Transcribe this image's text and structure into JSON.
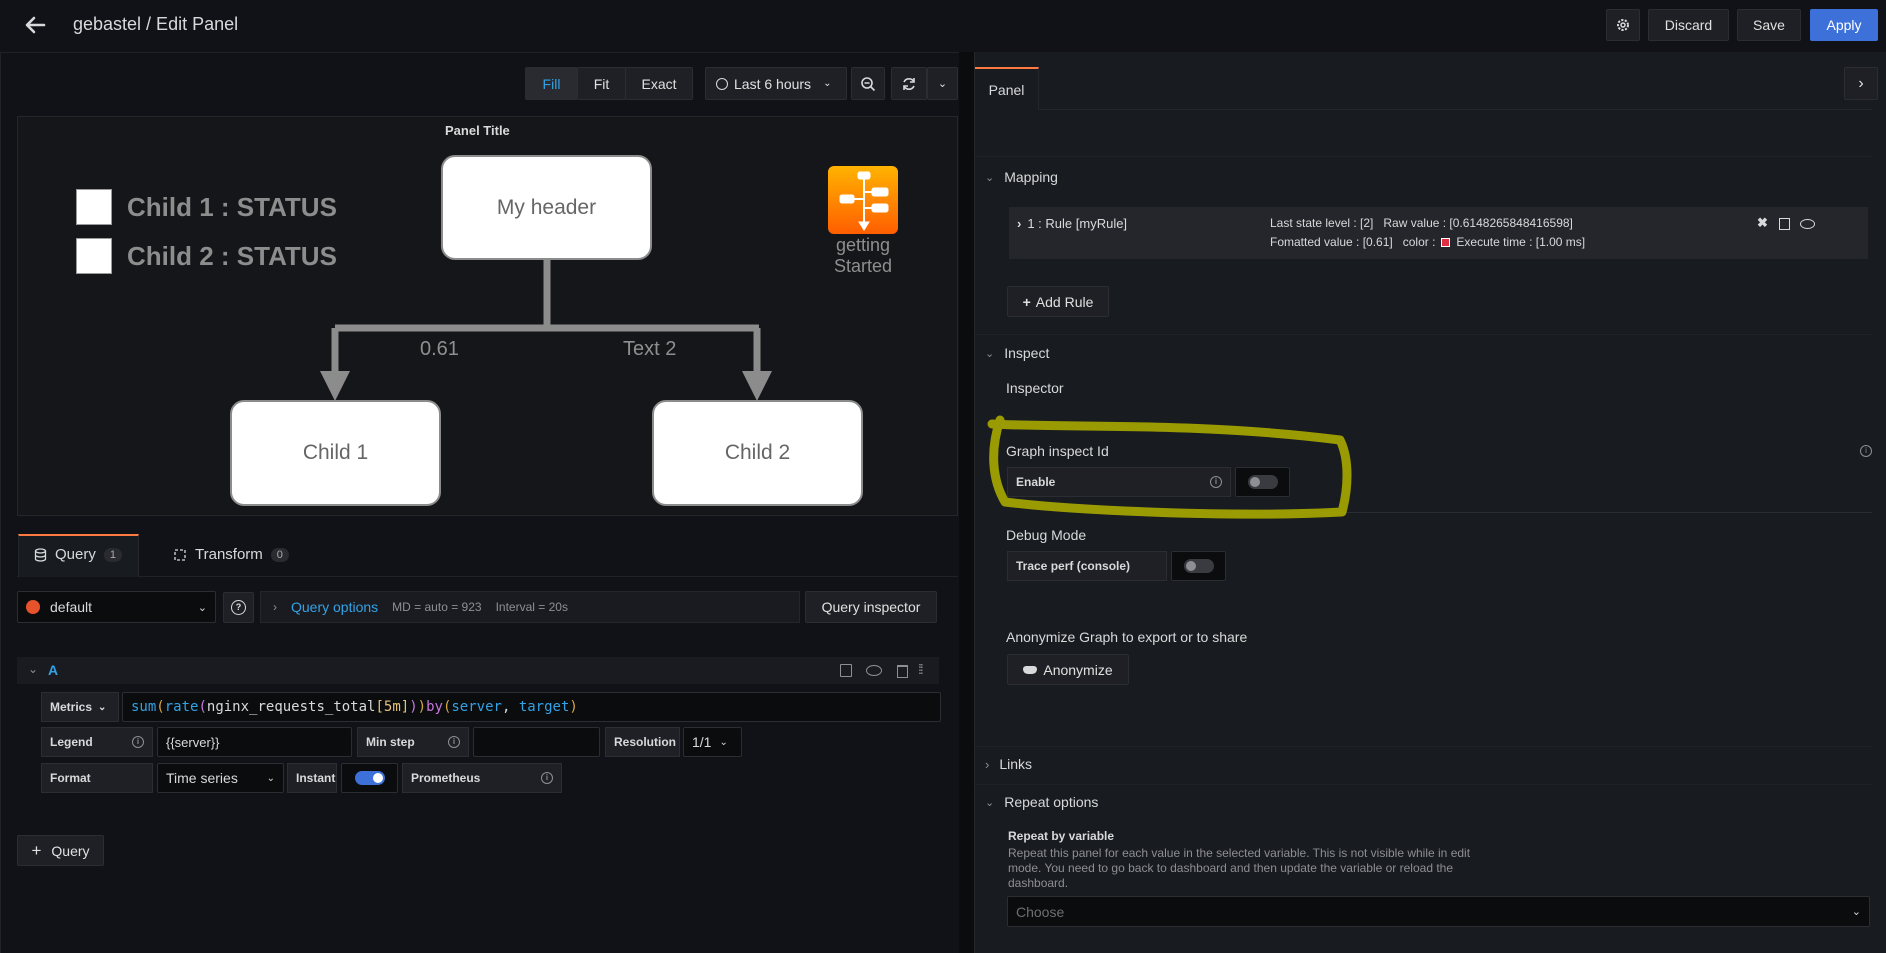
{
  "header": {
    "title": "gebastel / Edit Panel",
    "discard": "Discard",
    "save": "Save",
    "apply": "Apply"
  },
  "viz_toolbar": {
    "fill": "Fill",
    "fit": "Fit",
    "exact": "Exact",
    "time_range": "Last 6 hours"
  },
  "panel": {
    "title": "Panel Title",
    "header_node": "My header",
    "child1": "Child 1",
    "child2": "Child 2",
    "link1": "0.61",
    "link2": "Text 2",
    "status1": "Child 1 : STATUS",
    "status2": "Child 2 : STATUS",
    "getting_started_1": "getting",
    "getting_started_2": "Started"
  },
  "query_tabs": {
    "query": "Query",
    "query_count": "1",
    "transform": "Transform",
    "transform_count": "0"
  },
  "query_bar": {
    "datasource": "default",
    "options": "Query options",
    "md": "MD = auto = 923",
    "interval": "Interval = 20s",
    "inspector": "Query inspector"
  },
  "query_a": {
    "ref": "A",
    "metrics_label": "Metrics",
    "expr_sum": "sum",
    "expr_rate": "rate",
    "expr_metric": "nginx_requests_total",
    "expr_range": "5m",
    "expr_by": "by",
    "expr_server": "server",
    "expr_target": "target",
    "legend_label": "Legend",
    "legend_value": "{{server}}",
    "minstep_label": "Min step",
    "resolution_label": "Resolution",
    "resolution_value": "1/1",
    "format_label": "Format",
    "format_value": "Time series",
    "instant_label": "Instant",
    "prometheus_label": "Prometheus",
    "add_query": "Query"
  },
  "options_pane": {
    "tab": "Panel",
    "mapping_title": "Mapping",
    "rule_name": "1 : Rule [myRule]",
    "rule_line1": "Last state level : [2]   Raw value : [0.6148265848416598]",
    "rule_line2a": "Fomatted value : [0.61]   color :",
    "rule_line2b": "Execute time : [1.00 ms]",
    "add_rule": "Add Rule",
    "inspect_title": "Inspect",
    "inspector": "Inspector",
    "graph_inspect": "Graph inspect Id",
    "enable": "Enable",
    "debug_mode": "Debug Mode",
    "trace_perf": "Trace perf (console)",
    "anonymize_label": "Anonymize Graph to export or to share",
    "anonymize_button": "Anonymize",
    "links_title": "Links",
    "repeat_title": "Repeat options",
    "repeat_by": "Repeat by variable",
    "repeat_desc": "Repeat this panel for each value in the selected variable. This is not visible while in edit mode. You need to go back to dashboard and then update the variable or reload the dashboard.",
    "choose_placeholder": "Choose"
  },
  "colors": {
    "accent": "#3d71d9",
    "annotation": "#a8a800",
    "rule_color": "#e02f44"
  }
}
